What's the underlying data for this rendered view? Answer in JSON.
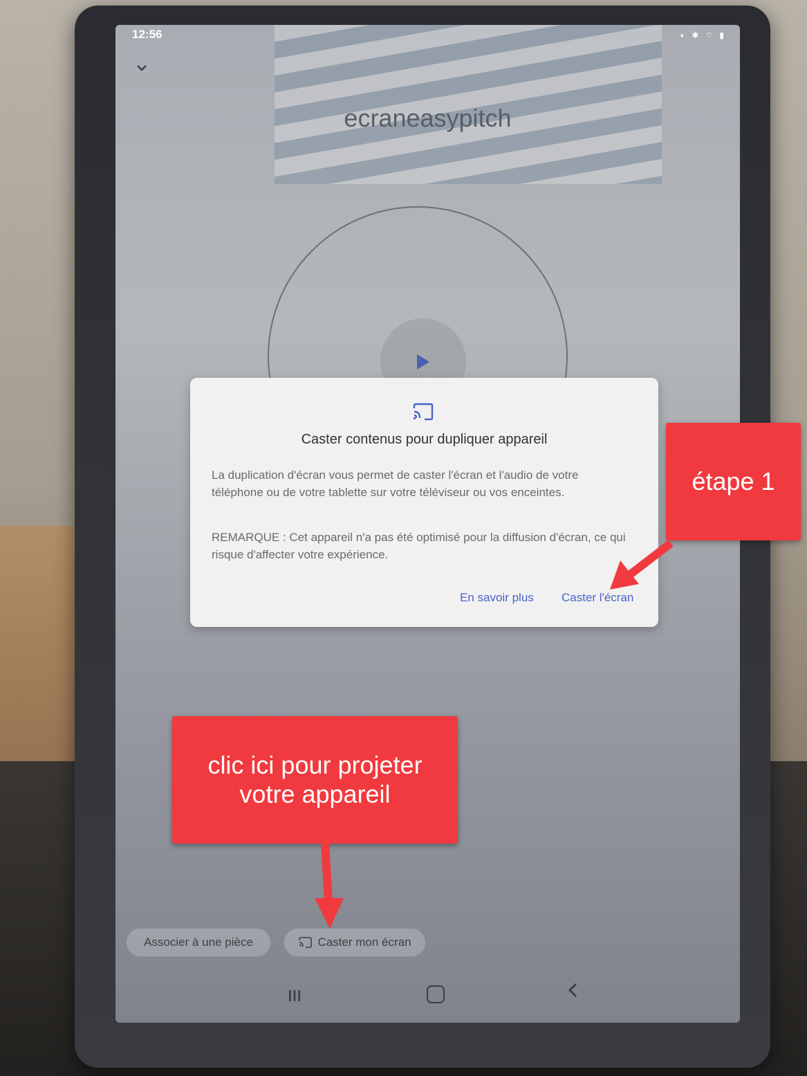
{
  "status_bar": {
    "time": "12:56",
    "icons": "◐ ✱ ⌔ ▮"
  },
  "device": {
    "name": "ecraneasypitch"
  },
  "dialog": {
    "icon": "cast-icon",
    "title": "Caster contenus pour dupliquer appareil",
    "body": "La duplication d'écran vous permet de caster l'écran et l'audio de votre téléphone ou de votre tablette sur votre téléviseur ou vos enceintes.",
    "note": "REMARQUE : Cet appareil n'a pas été optimisé pour la diffusion d'écran, ce qui risque d'affecter votre expérience.",
    "learn_more_label": "En savoir plus",
    "cast_label": "Caster l'écran"
  },
  "chips": {
    "room_label": "Associer à une pièce",
    "cast_label": "Caster mon écran"
  },
  "annotations": {
    "step_label": "étape 1",
    "click_line1": "clic ici pour projeter",
    "click_line2": "votre appareil"
  },
  "colors": {
    "callout": "#f03a3f",
    "accent": "#4a63c9"
  }
}
